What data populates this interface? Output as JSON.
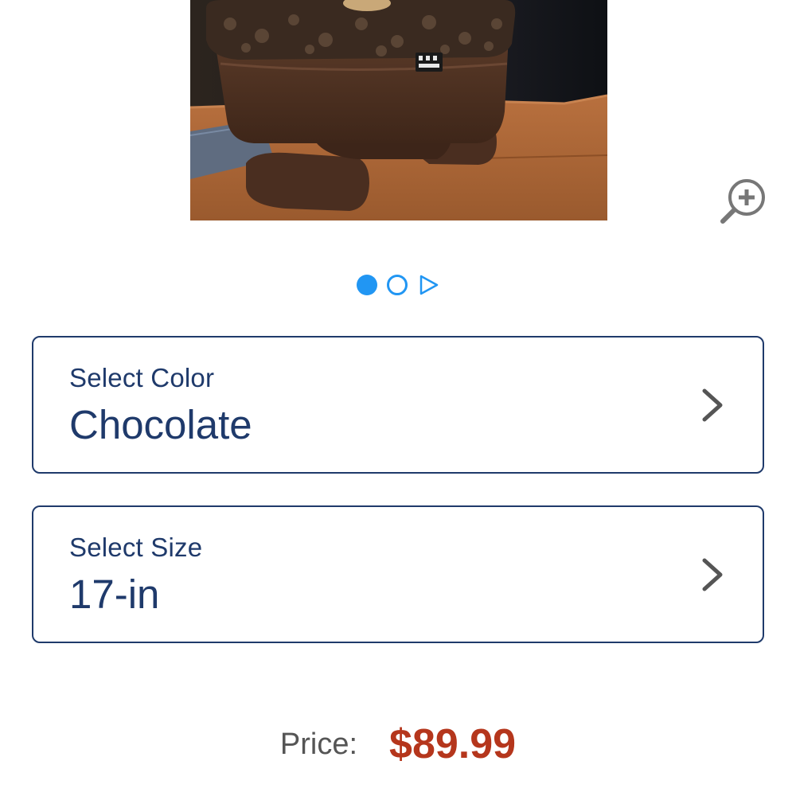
{
  "product": {
    "image_alt": "Pet Gear car booster seat",
    "brand_mark": "PET GEAR"
  },
  "carousel": {
    "total_pages": 2,
    "current_page": 1
  },
  "color_selector": {
    "label": "Select Color",
    "value": "Chocolate"
  },
  "size_selector": {
    "label": "Select Size",
    "value": "17-in"
  },
  "price": {
    "label": "Price:",
    "value": "$89.99"
  },
  "colors": {
    "accent_blue": "#2196f3",
    "navy": "#1f3a6b",
    "price_red": "#b5361c",
    "chevron_gray": "#555555"
  },
  "icons": {
    "zoom": "zoom-in-icon",
    "next": "play-triangle-icon",
    "chevron": "chevron-right-icon"
  }
}
